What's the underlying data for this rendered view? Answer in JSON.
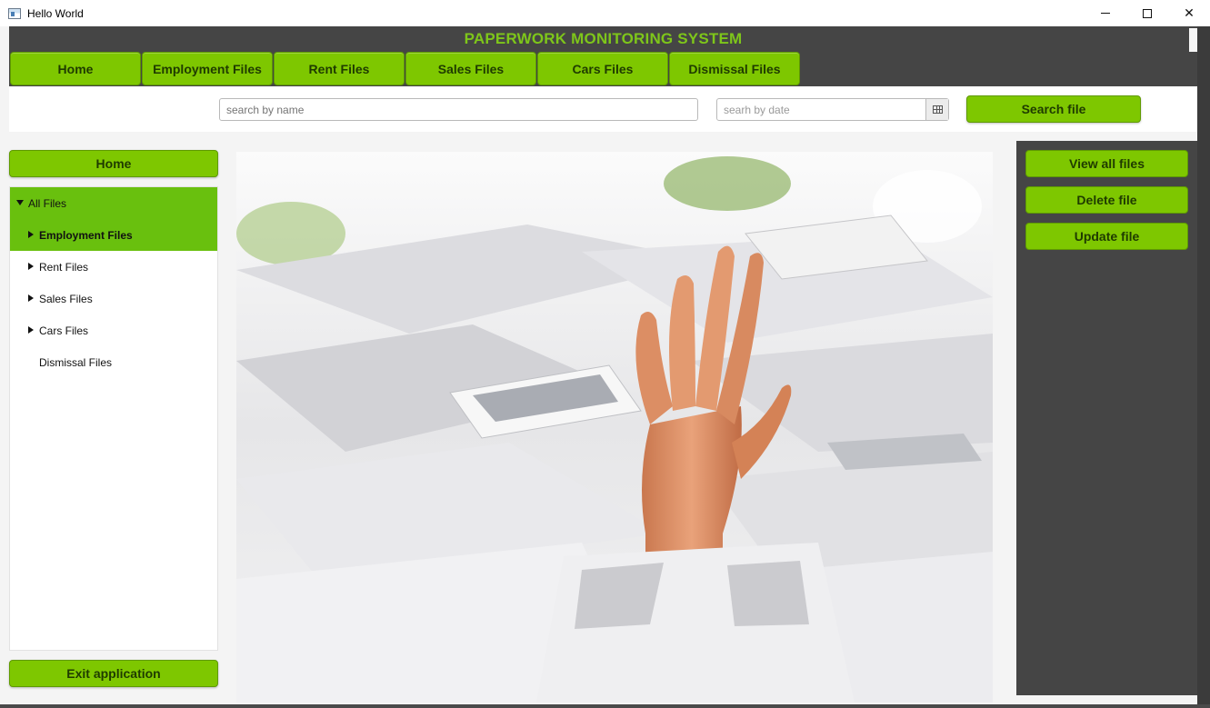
{
  "window": {
    "title": "Hello World",
    "minimize": "minimize",
    "maximize": "maximize",
    "close": "✕"
  },
  "header": {
    "brand": "PAPERWORK MONITORING SYSTEM"
  },
  "nav": {
    "items": [
      {
        "label": "Home"
      },
      {
        "label": "Employment Files"
      },
      {
        "label": "Rent Files"
      },
      {
        "label": "Sales Files"
      },
      {
        "label": "Cars Files"
      },
      {
        "label": "Dismissal Files"
      }
    ]
  },
  "search": {
    "name_placeholder": "search by name",
    "date_placeholder": "searh by date",
    "button_label": "Search file"
  },
  "sidebar": {
    "home_label": "Home",
    "tree": [
      {
        "label": "All Files",
        "expanded": true,
        "selected": true
      },
      {
        "label": "Employment Files",
        "expanded": false,
        "selected": true
      },
      {
        "label": "Rent Files",
        "expanded": false
      },
      {
        "label": "Sales Files",
        "expanded": false
      },
      {
        "label": "Cars Files",
        "expanded": false
      },
      {
        "label": "Dismissal Files"
      }
    ],
    "exit_label": "Exit application"
  },
  "actions": {
    "view_label": "View all files",
    "delete_label": "Delete file",
    "update_label": "Update file"
  },
  "colors": {
    "accent": "#7ec700",
    "accent_selected": "#69c00e",
    "brand_text": "#7ec61a",
    "dark_panel": "#454545"
  }
}
